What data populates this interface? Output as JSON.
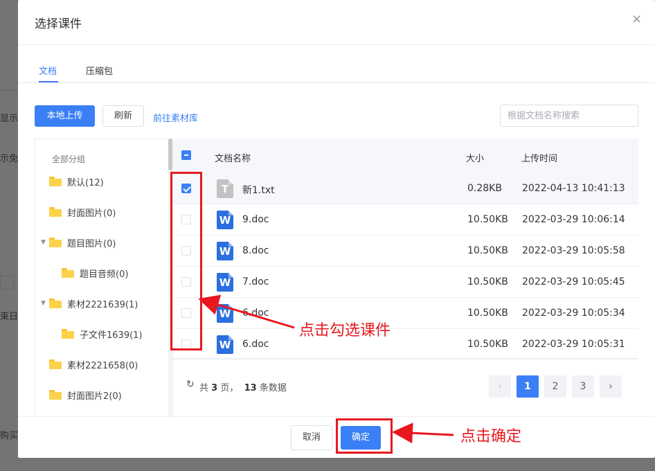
{
  "background": {
    "fragments": [
      "显示",
      "示免",
      "束日",
      "购买"
    ]
  },
  "dialog": {
    "title": "选择课件",
    "close_icon": "close-icon",
    "tabs": [
      {
        "label": "文档",
        "active": true
      },
      {
        "label": "压缩包",
        "active": false
      }
    ],
    "toolbar": {
      "upload_label": "本地上传",
      "refresh_label": "刷新",
      "library_link": "前往素材库",
      "search_placeholder": "根据文档名称搜索"
    },
    "tree": {
      "header": "全部分组",
      "nodes": [
        {
          "label": "默认(12)"
        },
        {
          "label": "封面图片(0)"
        },
        {
          "label": "题目图片(0)",
          "expanded": true
        },
        {
          "label": "题目音频(0)",
          "child": true
        },
        {
          "label": "素材2221639(1)",
          "expanded": true
        },
        {
          "label": "子文件1639(1)",
          "child": true
        },
        {
          "label": "素材2221658(0)"
        },
        {
          "label": "封面图片2(0)"
        }
      ]
    },
    "table": {
      "columns": [
        "文档名称",
        "大小",
        "上传时间"
      ],
      "rows": [
        {
          "name": "新1.txt",
          "type": "txt",
          "icon_letter": "T",
          "size": "0.28KB",
          "time": "2022-04-13 10:41:13",
          "checked": true
        },
        {
          "name": "9.doc",
          "type": "doc",
          "icon_letter": "W",
          "size": "10.50KB",
          "time": "2022-03-29 10:06:14",
          "checked": false
        },
        {
          "name": "8.doc",
          "type": "doc",
          "icon_letter": "W",
          "size": "10.50KB",
          "time": "2022-03-29 10:05:58",
          "checked": false
        },
        {
          "name": "7.doc",
          "type": "doc",
          "icon_letter": "W",
          "size": "10.50KB",
          "time": "2022-03-29 10:05:45",
          "checked": false
        },
        {
          "name": "6.doc",
          "type": "doc",
          "icon_letter": "W",
          "size": "10.50KB",
          "time": "2022-03-29 10:05:34",
          "checked": false
        },
        {
          "name": "6.doc",
          "type": "doc",
          "icon_letter": "W",
          "size": "10.50KB",
          "time": "2022-03-29 10:05:31",
          "checked": false
        }
      ]
    },
    "pagination": {
      "prefix": "共",
      "pages_total": "3",
      "pages_suffix": "页，",
      "records_total": "13",
      "records_suffix": "条数据",
      "prev": "‹",
      "next": "›",
      "pages": [
        "1",
        "2",
        "3"
      ],
      "current": "1"
    },
    "footer": {
      "cancel_label": "取消",
      "confirm_label": "确定"
    }
  },
  "annotations": {
    "select_hint": "点击勾选课件",
    "confirm_hint": "点击确定",
    "color": "#e8181e"
  },
  "colors": {
    "primary": "#3a7ff5",
    "folder": "#fcd24a",
    "doc_icon": "#2b6fe0",
    "txt_icon": "#c2c2c2"
  }
}
